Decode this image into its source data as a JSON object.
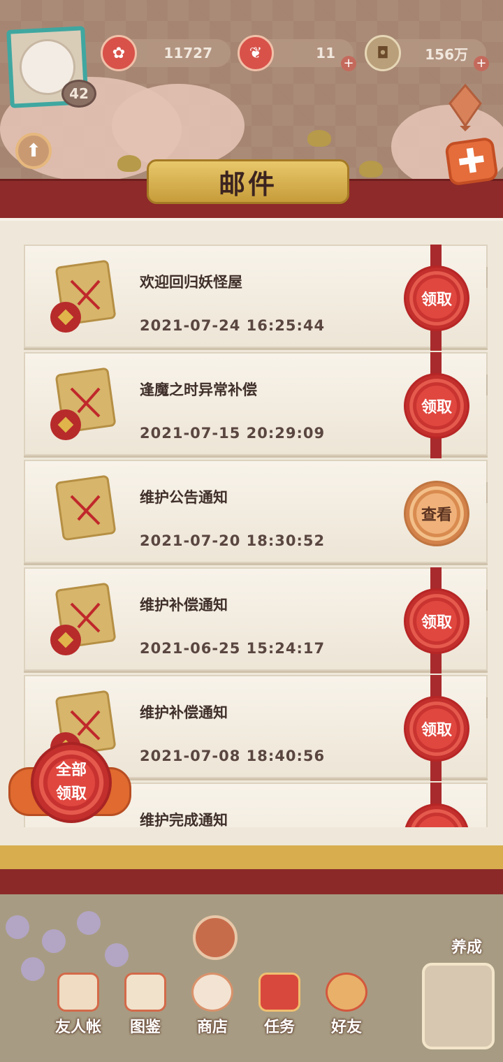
{
  "header": {
    "level": "42",
    "resources": [
      {
        "name": "plum-currency",
        "value": "11727"
      },
      {
        "name": "stamina",
        "value": "11"
      },
      {
        "name": "coins",
        "value": "156万"
      }
    ],
    "title": "邮件"
  },
  "mails": [
    {
      "title": "欢迎回归妖怪屋",
      "date": "2021-07-24 16:25:44",
      "action": "领取",
      "has_bag": true
    },
    {
      "title": "逢魔之时异常补偿",
      "date": "2021-07-15 20:29:09",
      "action": "领取",
      "has_bag": true
    },
    {
      "title": "维护公告通知",
      "date": "2021-07-20 18:30:52",
      "action": "查看",
      "has_bag": false
    },
    {
      "title": "维护补偿通知",
      "date": "2021-06-25 15:24:17",
      "action": "领取",
      "has_bag": true
    },
    {
      "title": "维护补偿通知",
      "date": "2021-07-08 18:40:56",
      "action": "领取",
      "has_bag": true
    },
    {
      "title": "维护完成通知",
      "date": "",
      "action": "领取",
      "has_bag": false
    }
  ],
  "claim_all": {
    "line1": "全部",
    "line2": "领取"
  },
  "bottom_nav": [
    {
      "label": "友人帐",
      "icon": "friend-book-icon"
    },
    {
      "label": "图鉴",
      "icon": "eye-scroll-icon"
    },
    {
      "label": "商店",
      "icon": "cat-shop-icon"
    },
    {
      "label": "任务",
      "icon": "task-box-icon"
    },
    {
      "label": "好友",
      "icon": "friends-icon"
    }
  ],
  "nurture_label": "养成",
  "colors": {
    "ribbon_red": "#a82a2c",
    "knot_red": "#e0473f",
    "knot_orange": "#f0b27a",
    "title_gold": "#d7b14e",
    "panel_bg": "#efe8da"
  }
}
